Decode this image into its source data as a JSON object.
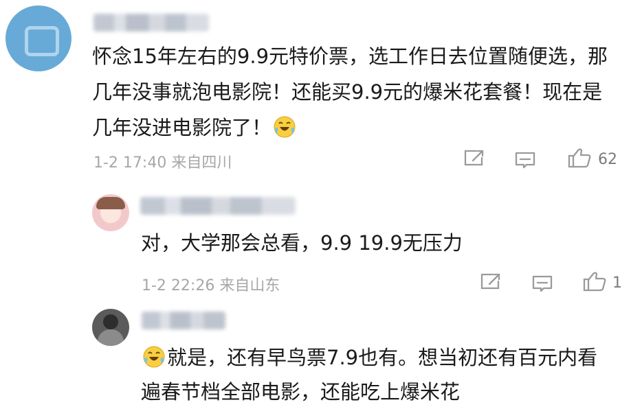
{
  "comments": [
    {
      "avatar": "blurred-avatar",
      "username": "IMMO王石榴",
      "text": "怀念15年左右的9.9元特价票，选工作日去位置随便选，那几年没事就泡电影院！还能买9.9元的爆米花套餐！现在是几年没进电影院了！",
      "emoji": "laugh-cry",
      "time": "1-2 17:40",
      "location": "来自四川",
      "likes": "62",
      "icons": {
        "share": "share-icon",
        "comment": "comment-icon",
        "like": "like-icon"
      }
    },
    {
      "avatar": "blurred-avatar",
      "username": "爆笑的打工圣伴",
      "text": "对，大学那会总看，9.9 19.9无压力",
      "time": "1-2 22:26",
      "location": "来自山东",
      "likes": "1",
      "icons": {
        "share": "share-icon",
        "comment": "comment-icon",
        "like": "like-icon"
      }
    },
    {
      "avatar": "blurred-avatar",
      "username": "200的猫",
      "emoji": "laugh-cry",
      "text": "就是，还有早鸟票7.9也有。想当初还有百元内看遍春节档全部电影，还能吃上爆米花"
    }
  ],
  "colors": {
    "text": "#1a1a1a",
    "meta": "#a7a7a7",
    "icon": "#9a9a9a",
    "background": "#ffffff"
  }
}
